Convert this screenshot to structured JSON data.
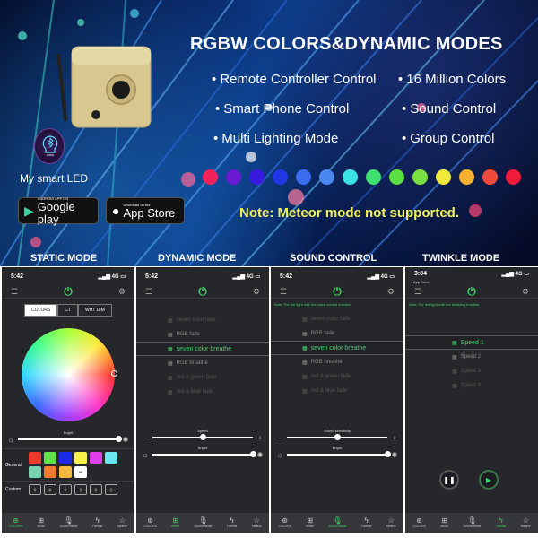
{
  "banner": {
    "title": "RGBW COLORS&DYNAMIC MODES",
    "features": [
      "Remote Controller Control",
      "16 Million Colors",
      "Smart Phone Control",
      "Sound Control",
      "Multi Lighting Mode",
      "Group Control"
    ],
    "app_name": "My smart LED",
    "google_play": {
      "small": "ANDROID APP ON",
      "big": "Google play"
    },
    "app_store": {
      "small": "Download on the",
      "big": "App Store"
    },
    "note": "Note:  Meteor mode not supported.",
    "color_dots": [
      "#f0245a",
      "#6a1ad0",
      "#3a1ae0",
      "#2236e8",
      "#3a6cf0",
      "#4a88f0",
      "#3ee0e8",
      "#3ee070",
      "#5ae040",
      "#7ae040",
      "#f0e83a",
      "#f8b030",
      "#f04a3a",
      "#f01a3a"
    ],
    "mode_labels": [
      "STATIC MODE",
      "DYNAMIC MODE",
      "SOUND CONTROL",
      "TWINKLE MODE"
    ]
  },
  "nav": [
    "COLORS",
    "Mode",
    "Sound Mode",
    "Twinkle",
    "Meteor"
  ],
  "phones": {
    "static": {
      "time": "5:42",
      "network": "4G",
      "segments": [
        "COLORS",
        "CT",
        "WHT DIM"
      ],
      "active_segment": "COLORS",
      "bright_label": "Bright",
      "bright_value": 1.0,
      "general_label": "General",
      "custom_label": "Custom",
      "swatches": [
        {
          "color": "#ee3a2a",
          "label": ""
        },
        {
          "color": "#5ee04a",
          "label": ""
        },
        {
          "color": "#1a2ae8",
          "label": ""
        },
        {
          "color": "#f8f048",
          "label": ""
        },
        {
          "color": "#e040e8",
          "label": ""
        },
        {
          "color": "#6ae6f0",
          "label": ""
        },
        {
          "color": "#78d4b0",
          "label": ""
        },
        {
          "color": "#f07a30",
          "label": ""
        },
        {
          "color": "#f4b840",
          "label": ""
        },
        {
          "color": "#ffffff",
          "label": "W"
        }
      ],
      "custom_slots": [
        "+",
        "+",
        "+",
        "+",
        "+",
        "+"
      ],
      "active_nav": "COLORS"
    },
    "dynamic": {
      "time": "5:42",
      "network": "4G",
      "modes": [
        "seven color fade",
        "RGB fade",
        "seven color breathe",
        "RGB breathe",
        "red & green fade",
        "red & blue fade"
      ],
      "selected_mode": "seven color breathe",
      "speed_label": "Speed",
      "speed_value": 0.5,
      "bright_label": "Bright",
      "bright_value": 1.0,
      "active_nav": "Mode"
    },
    "sound": {
      "time": "5:42",
      "network": "4G",
      "note": "Note: For the light with the voice control function",
      "modes": [
        "seven color fade",
        "RGB fade",
        "seven color breathe",
        "RGB breathe",
        "red & green fade",
        "red & blue fade"
      ],
      "selected_mode": "seven color breathe",
      "sensitivity_label": "Sound sensitivity",
      "sensitivity_value": 0.5,
      "bright_label": "Bright",
      "bright_value": 1.0,
      "active_nav": "Sound Mode"
    },
    "twinkle": {
      "time": "3:04",
      "back_label": "◂ App Store",
      "network": "4G",
      "note": "Note: For the light with the twinkling function",
      "speeds": [
        "Speed 1",
        "Speed 2",
        "Speed 3",
        "Speed 4"
      ],
      "selected_speed": "Speed 1",
      "pause_icon": "❚❚",
      "play_icon": "▶",
      "active_nav": "Twinkle"
    }
  }
}
